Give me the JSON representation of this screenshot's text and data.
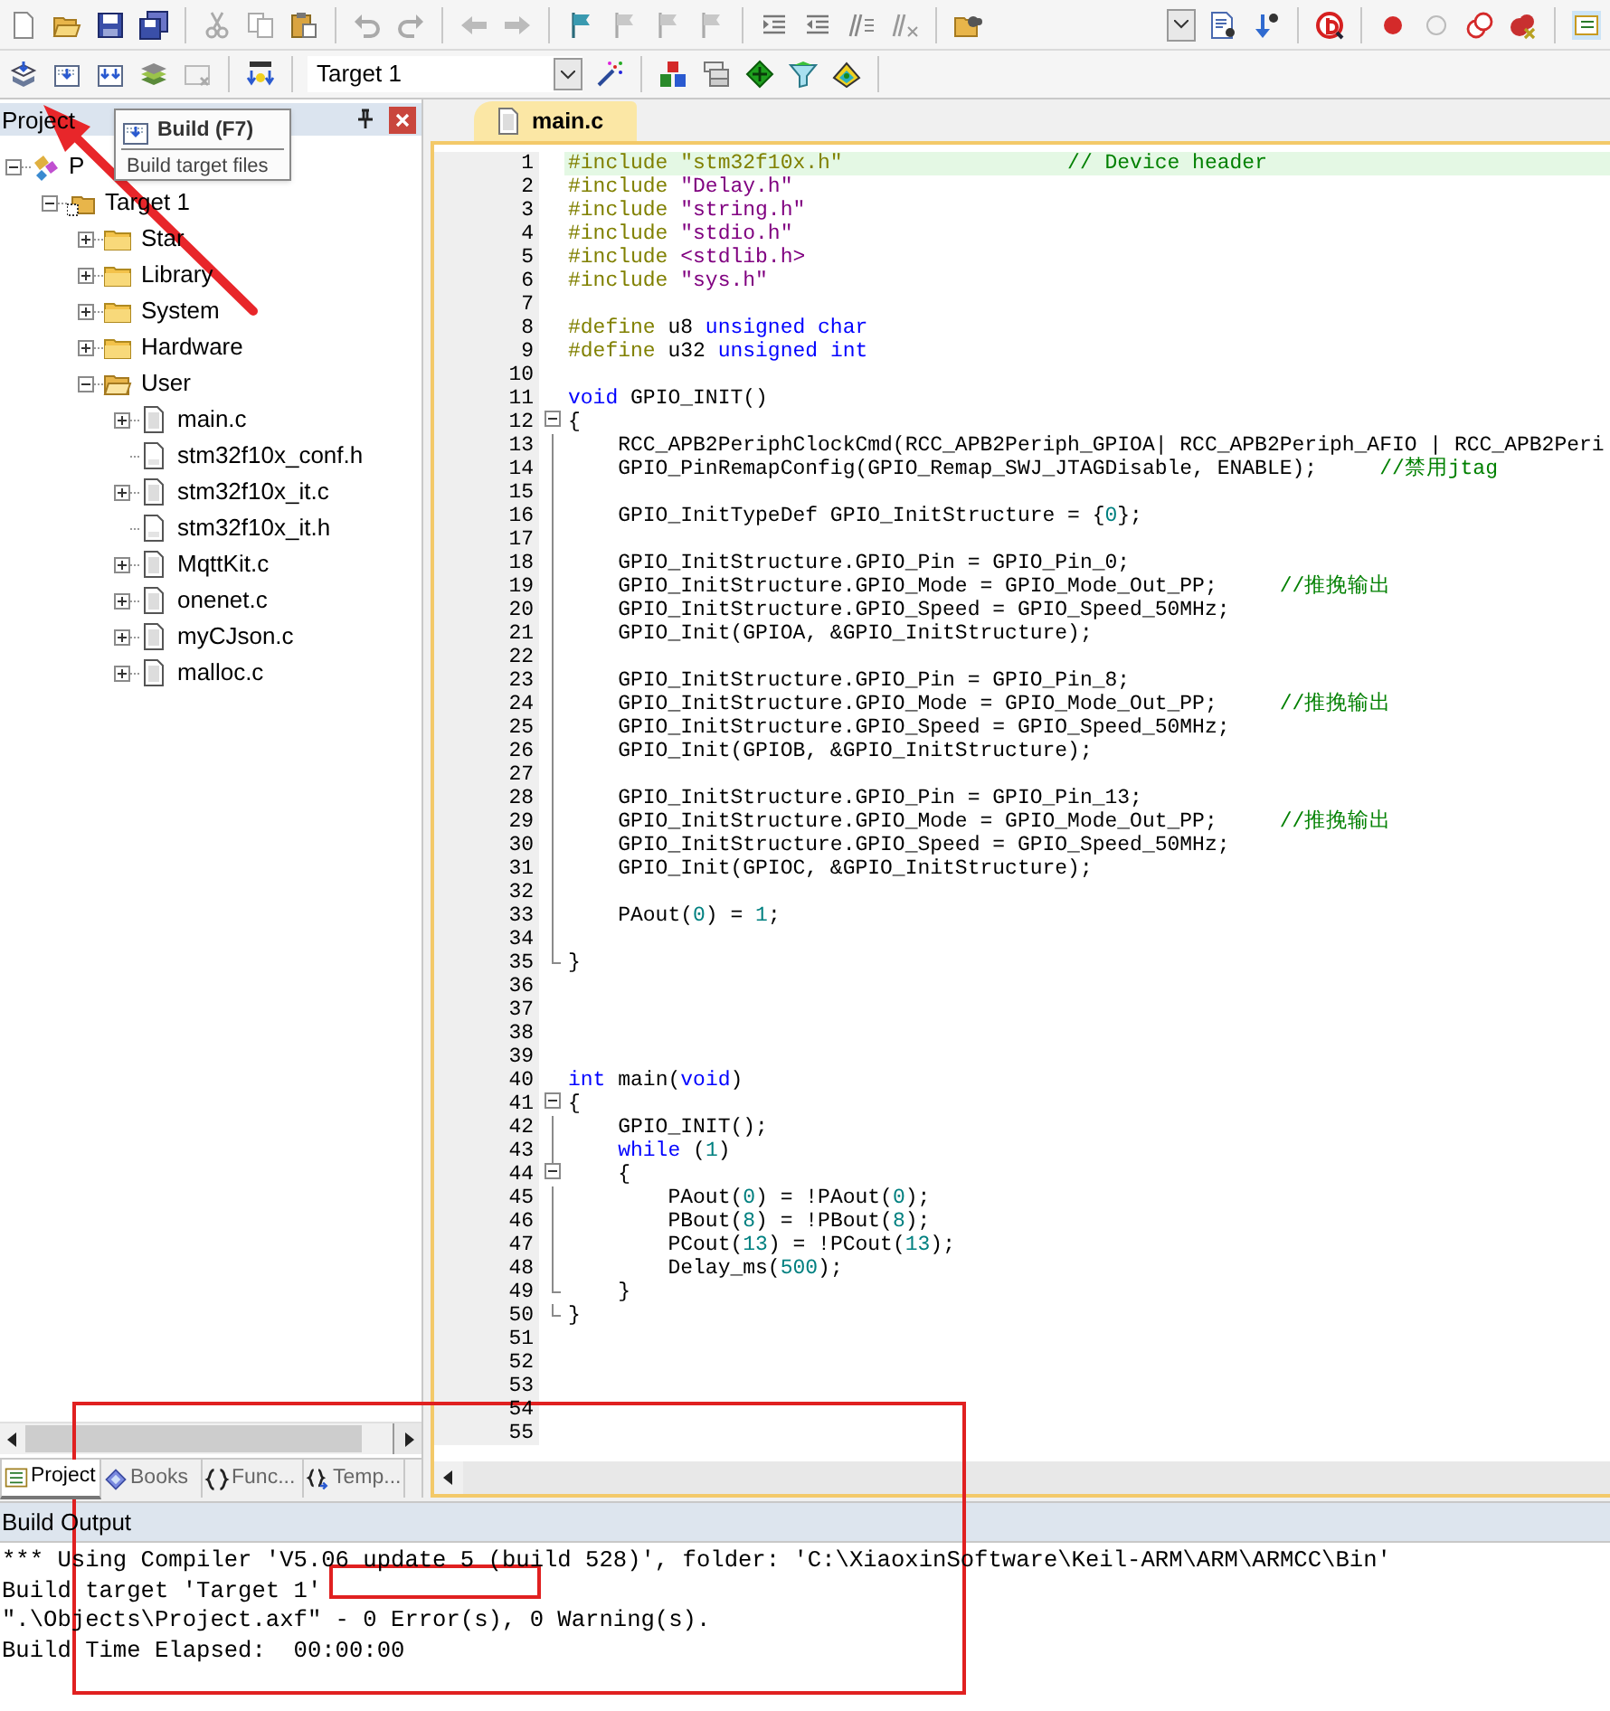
{
  "toolbar": {
    "target_select": {
      "value": "Target 1"
    }
  },
  "tooltip": {
    "title": "Build (F7)",
    "description": "Build target files"
  },
  "project_panel": {
    "title": "Project",
    "tree": [
      {
        "label": "P",
        "kind": "project",
        "expanded": true,
        "children": [
          {
            "label": "Target 1",
            "kind": "target",
            "expanded": true,
            "children": [
              {
                "label": "Star",
                "kind": "folder",
                "expanded": false
              },
              {
                "label": "Library",
                "kind": "folder",
                "expanded": false
              },
              {
                "label": "System",
                "kind": "folder",
                "expanded": false
              },
              {
                "label": "Hardware",
                "kind": "folder",
                "expanded": false
              },
              {
                "label": "User",
                "kind": "folder",
                "expanded": true,
                "children": [
                  {
                    "label": "main.c",
                    "kind": "file",
                    "expanded": false
                  },
                  {
                    "label": "stm32f10x_conf.h",
                    "kind": "header"
                  },
                  {
                    "label": "stm32f10x_it.c",
                    "kind": "file",
                    "expanded": false
                  },
                  {
                    "label": "stm32f10x_it.h",
                    "kind": "header"
                  },
                  {
                    "label": "MqttKit.c",
                    "kind": "file",
                    "expanded": false
                  },
                  {
                    "label": "onenet.c",
                    "kind": "file",
                    "expanded": false
                  },
                  {
                    "label": "myCJson.c",
                    "kind": "file",
                    "expanded": false
                  },
                  {
                    "label": "malloc.c",
                    "kind": "file",
                    "expanded": false
                  }
                ]
              }
            ]
          }
        ]
      }
    ],
    "tabs": [
      {
        "label": "Project",
        "kind": "project",
        "selected": true
      },
      {
        "label": "Books",
        "kind": "books",
        "selected": false
      },
      {
        "label": "Func...",
        "kind": "functions",
        "selected": false
      },
      {
        "label": "Temp...",
        "kind": "templates",
        "selected": false
      }
    ]
  },
  "editor": {
    "tabs": [
      {
        "label": "main.c",
        "selected": true
      }
    ],
    "lines": [
      {
        "number": "1",
        "kind": "line",
        "current": true,
        "segments": [
          {
            "text": "#include \"stm32f10x.h\"                  ",
            "kind": "directive"
          },
          {
            "text": "// Device header",
            "kind": "comment"
          }
        ]
      },
      {
        "number": "2",
        "kind": "line",
        "current": false,
        "segments": [
          {
            "text": "#include ",
            "kind": "directive"
          },
          {
            "text": "\"Delay.h\"",
            "kind": "string"
          }
        ]
      },
      {
        "number": "3",
        "kind": "line",
        "current": false,
        "segments": [
          {
            "text": "#include ",
            "kind": "directive"
          },
          {
            "text": "\"string.h\"",
            "kind": "string"
          }
        ]
      },
      {
        "number": "4",
        "kind": "line",
        "current": false,
        "segments": [
          {
            "text": "#include ",
            "kind": "directive"
          },
          {
            "text": "\"stdio.h\"",
            "kind": "string"
          }
        ]
      },
      {
        "number": "5",
        "kind": "line",
        "current": false,
        "segments": [
          {
            "text": "#include ",
            "kind": "directive"
          },
          {
            "text": "<stdlib.h>",
            "kind": "string"
          }
        ]
      },
      {
        "number": "6",
        "kind": "line",
        "current": false,
        "segments": [
          {
            "text": "#include ",
            "kind": "directive"
          },
          {
            "text": "\"sys.h\"",
            "kind": "string"
          }
        ]
      },
      {
        "number": "7",
        "kind": "line",
        "current": false
      },
      {
        "number": "8",
        "kind": "line",
        "current": false,
        "segments": [
          {
            "text": "#define",
            "kind": "directive"
          },
          {
            "text": " u8 ",
            "kind": "plain"
          },
          {
            "text": "unsigned char",
            "kind": "keyword"
          }
        ]
      },
      {
        "number": "9",
        "kind": "line",
        "current": false,
        "segments": [
          {
            "text": "#define",
            "kind": "directive"
          },
          {
            "text": " u32 ",
            "kind": "plain"
          },
          {
            "text": "unsigned int",
            "kind": "keyword"
          }
        ]
      },
      {
        "number": "10",
        "kind": "line",
        "current": false
      },
      {
        "number": "11",
        "kind": "line",
        "current": false,
        "segments": [
          {
            "text": "void",
            "kind": "keyword"
          },
          {
            "text": " GPIO_INIT()",
            "kind": "plain"
          }
        ]
      },
      {
        "number": "12",
        "kind": "block_start",
        "current": false,
        "segments": [
          {
            "text": "{",
            "kind": "plain"
          }
        ]
      },
      {
        "number": "13",
        "kind": "line",
        "current": false,
        "segments": [
          {
            "text": "    RCC_APB2PeriphClockCmd(RCC_APB2Periph_GPIOA| RCC_APB2Periph_AFIO | RCC_APB2Peri",
            "kind": "plain"
          }
        ]
      },
      {
        "number": "14",
        "kind": "line",
        "current": false,
        "segments": [
          {
            "text": "    GPIO_PinRemapConfig(GPIO_Remap_SWJ_JTAGDisable, ENABLE);     ",
            "kind": "plain"
          },
          {
            "text": "//禁用jtag",
            "kind": "comment"
          }
        ]
      },
      {
        "number": "15",
        "kind": "line",
        "current": false
      },
      {
        "number": "16",
        "kind": "line",
        "current": false,
        "segments": [
          {
            "text": "    GPIO_InitTypeDef GPIO_InitStructure = {",
            "kind": "plain"
          },
          {
            "text": "0",
            "kind": "number"
          },
          {
            "text": "};",
            "kind": "plain"
          }
        ]
      },
      {
        "number": "17",
        "kind": "line",
        "current": false
      },
      {
        "number": "18",
        "kind": "line",
        "current": false,
        "segments": [
          {
            "text": "    GPIO_InitStructure.GPIO_Pin = GPIO_Pin_0;",
            "kind": "plain"
          }
        ]
      },
      {
        "number": "19",
        "kind": "line",
        "current": false,
        "segments": [
          {
            "text": "    GPIO_InitStructure.GPIO_Mode = GPIO_Mode_Out_PP;     ",
            "kind": "plain"
          },
          {
            "text": "//推挽输出",
            "kind": "comment"
          }
        ]
      },
      {
        "number": "20",
        "kind": "line",
        "current": false,
        "segments": [
          {
            "text": "    GPIO_InitStructure.GPIO_Speed = GPIO_Speed_50MHz;",
            "kind": "plain"
          }
        ]
      },
      {
        "number": "21",
        "kind": "line",
        "current": false,
        "segments": [
          {
            "text": "    GPIO_Init(GPIOA, &GPIO_InitStructure);",
            "kind": "plain"
          }
        ]
      },
      {
        "number": "22",
        "kind": "line",
        "current": false
      },
      {
        "number": "23",
        "kind": "line",
        "current": false,
        "segments": [
          {
            "text": "    GPIO_InitStructure.GPIO_Pin = GPIO_Pin_8;",
            "kind": "plain"
          }
        ]
      },
      {
        "number": "24",
        "kind": "line",
        "current": false,
        "segments": [
          {
            "text": "    GPIO_InitStructure.GPIO_Mode = GPIO_Mode_Out_PP;     ",
            "kind": "plain"
          },
          {
            "text": "//推挽输出",
            "kind": "comment"
          }
        ]
      },
      {
        "number": "25",
        "kind": "line",
        "current": false,
        "segments": [
          {
            "text": "    GPIO_InitStructure.GPIO_Speed = GPIO_Speed_50MHz;",
            "kind": "plain"
          }
        ]
      },
      {
        "number": "26",
        "kind": "line",
        "current": false,
        "segments": [
          {
            "text": "    GPIO_Init(GPIOB, &GPIO_InitStructure);",
            "kind": "plain"
          }
        ]
      },
      {
        "number": "27",
        "kind": "line",
        "current": false
      },
      {
        "number": "28",
        "kind": "line",
        "current": false,
        "segments": [
          {
            "text": "    GPIO_InitStructure.GPIO_Pin = GPIO_Pin_13;",
            "kind": "plain"
          }
        ]
      },
      {
        "number": "29",
        "kind": "line",
        "current": false,
        "segments": [
          {
            "text": "    GPIO_InitStructure.GPIO_Mode = GPIO_Mode_Out_PP;     ",
            "kind": "plain"
          },
          {
            "text": "//推挽输出",
            "kind": "comment"
          }
        ]
      },
      {
        "number": "30",
        "kind": "line",
        "current": false,
        "segments": [
          {
            "text": "    GPIO_InitStructure.GPIO_Speed = GPIO_Speed_50MHz;",
            "kind": "plain"
          }
        ]
      },
      {
        "number": "31",
        "kind": "line",
        "current": false,
        "segments": [
          {
            "text": "    GPIO_Init(GPIOC, &GPIO_InitStructure);",
            "kind": "plain"
          }
        ]
      },
      {
        "number": "32",
        "kind": "line",
        "current": false
      },
      {
        "number": "33",
        "kind": "line",
        "current": false,
        "segments": [
          {
            "text": "    PAout(",
            "kind": "plain"
          },
          {
            "text": "0",
            "kind": "number"
          },
          {
            "text": ") = ",
            "kind": "plain"
          },
          {
            "text": "1",
            "kind": "number"
          },
          {
            "text": ";",
            "kind": "plain"
          }
        ]
      },
      {
        "number": "34",
        "kind": "line",
        "current": false
      },
      {
        "number": "35",
        "kind": "block_end",
        "current": false,
        "segments": [
          {
            "text": "}",
            "kind": "plain"
          }
        ]
      },
      {
        "number": "36",
        "kind": "line",
        "current": false
      },
      {
        "number": "37",
        "kind": "line",
        "current": false
      },
      {
        "number": "38",
        "kind": "line",
        "current": false
      },
      {
        "number": "39",
        "kind": "line",
        "current": false
      },
      {
        "number": "40",
        "kind": "line",
        "current": false,
        "segments": [
          {
            "text": "int",
            "kind": "keyword"
          },
          {
            "text": " main(",
            "kind": "plain"
          },
          {
            "text": "void",
            "kind": "keyword"
          },
          {
            "text": ")",
            "kind": "plain"
          }
        ]
      },
      {
        "number": "41",
        "kind": "block_start",
        "current": false,
        "segments": [
          {
            "text": "{",
            "kind": "plain"
          }
        ]
      },
      {
        "number": "42",
        "kind": "line",
        "current": false,
        "segments": [
          {
            "text": "    GPIO_INIT();",
            "kind": "plain"
          }
        ]
      },
      {
        "number": "43",
        "kind": "line",
        "current": false,
        "segments": [
          {
            "text": "    while",
            "kind": "keyword"
          },
          {
            "text": " (",
            "kind": "plain"
          },
          {
            "text": "1",
            "kind": "number"
          },
          {
            "text": ")",
            "kind": "plain"
          }
        ]
      },
      {
        "number": "44",
        "kind": "block_start",
        "current": false,
        "segments": [
          {
            "text": "    {",
            "kind": "plain"
          }
        ]
      },
      {
        "number": "45",
        "kind": "line",
        "current": false,
        "segments": [
          {
            "text": "        PAout(",
            "kind": "plain"
          },
          {
            "text": "0",
            "kind": "number"
          },
          {
            "text": ") = !PAout(",
            "kind": "plain"
          },
          {
            "text": "0",
            "kind": "number"
          },
          {
            "text": ");",
            "kind": "plain"
          }
        ]
      },
      {
        "number": "46",
        "kind": "line",
        "current": false,
        "segments": [
          {
            "text": "        PBout(",
            "kind": "plain"
          },
          {
            "text": "8",
            "kind": "number"
          },
          {
            "text": ") = !PBout(",
            "kind": "plain"
          },
          {
            "text": "8",
            "kind": "number"
          },
          {
            "text": ");",
            "kind": "plain"
          }
        ]
      },
      {
        "number": "47",
        "kind": "line",
        "current": false,
        "segments": [
          {
            "text": "        PCout(",
            "kind": "plain"
          },
          {
            "text": "13",
            "kind": "number"
          },
          {
            "text": ") = !PCout(",
            "kind": "plain"
          },
          {
            "text": "13",
            "kind": "number"
          },
          {
            "text": ");",
            "kind": "plain"
          }
        ]
      },
      {
        "number": "48",
        "kind": "line",
        "current": false,
        "segments": [
          {
            "text": "        Delay_ms(",
            "kind": "plain"
          },
          {
            "text": "500",
            "kind": "number"
          },
          {
            "text": ");",
            "kind": "plain"
          }
        ]
      },
      {
        "number": "49",
        "kind": "block_end",
        "current": false,
        "segments": [
          {
            "text": "    }",
            "kind": "plain"
          }
        ]
      },
      {
        "number": "50",
        "kind": "block_end",
        "current": false,
        "segments": [
          {
            "text": "}",
            "kind": "plain"
          }
        ]
      },
      {
        "number": "51",
        "kind": "line",
        "current": false
      },
      {
        "number": "52",
        "kind": "line",
        "current": false
      },
      {
        "number": "53",
        "kind": "line",
        "current": false
      },
      {
        "number": "54",
        "kind": "line",
        "current": false
      },
      {
        "number": "55",
        "kind": "line",
        "current": false
      }
    ]
  },
  "build_output": {
    "title": "Build Output",
    "lines": [
      "*** Using Compiler 'V5.06 update 5 (build 528)', folder: 'C:\\XiaoxinSoftware\\Keil-ARM\\ARM\\ARMCC\\Bin'",
      "Build target 'Target 1'",
      "\".\\Objects\\Project.axf\" - 0 Error(s), 0 Warning(s).",
      "Build Time Elapsed:  00:00:00"
    ]
  }
}
